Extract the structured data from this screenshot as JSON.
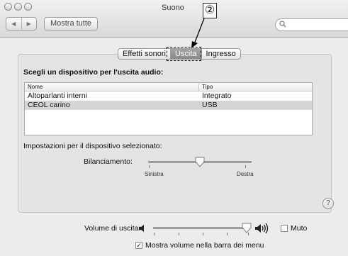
{
  "window": {
    "title": "Suono"
  },
  "toolbar": {
    "back_glyph": "◀",
    "forward_glyph": "▶",
    "show_all_label": "Mostra tutte",
    "search_placeholder": "",
    "search_icon": "magnifier-icon"
  },
  "callout": {
    "number": "②"
  },
  "tabs": [
    {
      "label": "Effetti sonori",
      "selected": false
    },
    {
      "label": "Uscita",
      "selected": true
    },
    {
      "label": "Ingresso",
      "selected": false
    }
  ],
  "output": {
    "heading": "Scegli un dispositivo per l'uscita audio:",
    "columns": [
      "Nome",
      "Tipo"
    ],
    "devices": [
      {
        "name": "Altoparlanti interni",
        "type": "Integrato",
        "selected": false
      },
      {
        "name": "CEOL carino",
        "type": "USB",
        "selected": true
      }
    ]
  },
  "settings": {
    "label": "Impostazioni per il dispositivo selezionato:",
    "balance_label": "Bilanciamento:",
    "balance_left": "Sinistra",
    "balance_right": "Destra",
    "balance_value": 0.5
  },
  "help": {
    "glyph": "?"
  },
  "volume": {
    "label": "Volume di uscita:",
    "level": 0.97,
    "mute_label": "Muto",
    "mute_checked": false,
    "show_in_menubar_label": "Mostra volume nella barra dei menu",
    "show_in_menubar_checked": true,
    "check_glyph": "✓"
  },
  "colors": {
    "selected_tab": "#8f8f8f",
    "selected_row": "#d6d6d6"
  }
}
